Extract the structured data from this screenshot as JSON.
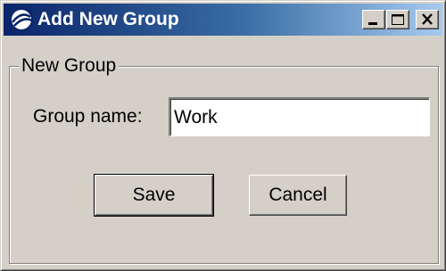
{
  "window": {
    "title": "Add New Group",
    "icon": "app-globe-icon",
    "controls": {
      "minimize_icon": "minimize-icon",
      "maximize_icon": "maximize-icon",
      "close_icon": "close-icon"
    }
  },
  "group_box": {
    "legend": "New Group"
  },
  "form": {
    "group_name_label": "Group name:",
    "group_name_value": "Work"
  },
  "buttons": {
    "save_label": "Save",
    "cancel_label": "Cancel"
  },
  "colors": {
    "titlebar_start": "#0a246a",
    "titlebar_end": "#a6caf0",
    "face": "#d4d0c8"
  }
}
